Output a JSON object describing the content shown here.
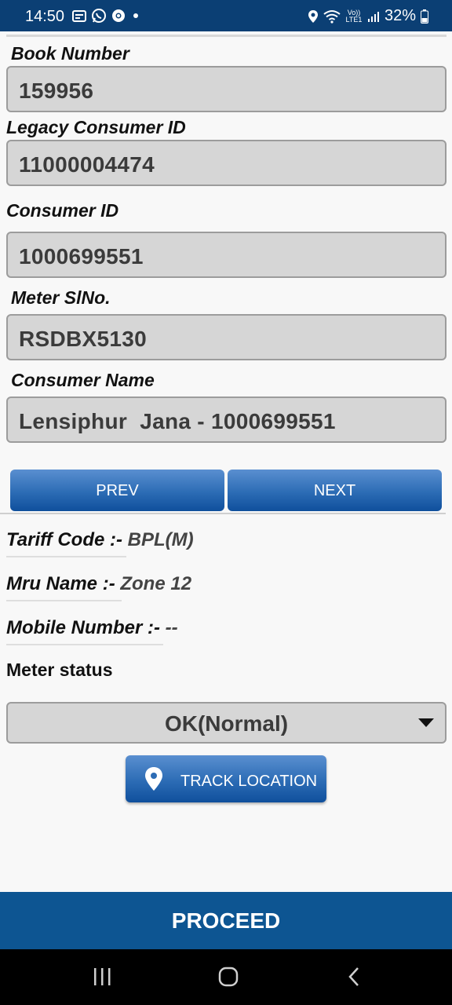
{
  "status_bar": {
    "time": "14:50",
    "battery": "32%",
    "left_icons": [
      "calendar-icon",
      "whatsapp-icon",
      "chrome-icon",
      "dot-icon"
    ],
    "right_icons": [
      "location-icon",
      "wifi-icon",
      "volte-icon",
      "signal-icon",
      "battery-icon"
    ],
    "volte_text": "Vo)) LTE1"
  },
  "form": {
    "book_number": {
      "label": "Book Number",
      "value": "159956"
    },
    "legacy_consumer_id": {
      "label": "Legacy Consumer ID",
      "value": "11000004474"
    },
    "consumer_id": {
      "label": "Consumer ID",
      "value": "1000699551"
    },
    "meter_slno": {
      "label": "Meter SlNo.",
      "value": "RSDBX5130"
    },
    "consumer_name": {
      "label": "Consumer Name",
      "value": "Lensiphur  Jana - 1000699551"
    }
  },
  "nav": {
    "prev": "PREV",
    "next": "NEXT"
  },
  "info": {
    "tariff": {
      "label": "Tariff Code :- ",
      "value": "BPL(M)"
    },
    "mru": {
      "label": "Mru Name :- ",
      "value": "Zone 12"
    },
    "mobile": {
      "label": "Mobile Number :- ",
      "value": "--"
    }
  },
  "meter_status": {
    "label": "Meter status",
    "selected": "OK(Normal)"
  },
  "track_location": {
    "label": "TRACK LOCATION",
    "icon": "location-pin-icon"
  },
  "proceed": "PROCEED",
  "system_nav": [
    "recent-apps-icon",
    "home-icon",
    "back-icon"
  ],
  "colors": {
    "primary": "#0d5592",
    "status_bar": "#0b3f74",
    "field_bg": "#d6d6d6"
  }
}
